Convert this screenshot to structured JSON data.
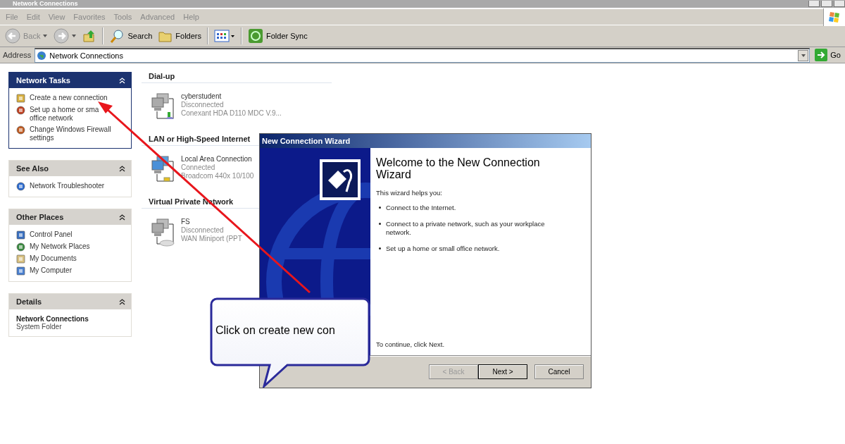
{
  "window": {
    "title": "Network Connections"
  },
  "menu": [
    "File",
    "Edit",
    "View",
    "Favorites",
    "Tools",
    "Advanced",
    "Help"
  ],
  "toolbar": [
    {
      "kind": "back",
      "label": "Back",
      "disabled": true
    },
    {
      "kind": "forward"
    },
    {
      "kind": "up"
    },
    {
      "kind": "separator"
    },
    {
      "kind": "search",
      "label": "Search"
    },
    {
      "kind": "folders",
      "label": "Folders"
    },
    {
      "kind": "separator"
    },
    {
      "kind": "views"
    },
    {
      "kind": "separator"
    },
    {
      "kind": "sync",
      "label": "Folder Sync"
    }
  ],
  "address": {
    "label": "Address",
    "value": "Network Connections",
    "go": "Go"
  },
  "sidebar": [
    {
      "title": "Network Tasks",
      "special": true,
      "expanded": true,
      "kind": "links",
      "items": [
        {
          "kind": "wizard",
          "label": "Create a new connection"
        },
        {
          "kind": "home",
          "label": "Set up a home or sma\noffice network"
        },
        {
          "kind": "firewall",
          "label": "Change Windows Firewall settings"
        }
      ]
    },
    {
      "title": "See Also",
      "special": false,
      "expanded": true,
      "kind": "links",
      "items": [
        {
          "kind": "info",
          "label": "Network Troubleshooter"
        }
      ]
    },
    {
      "title": "Other Places",
      "special": false,
      "expanded": true,
      "kind": "links",
      "items": [
        {
          "kind": "control",
          "label": "Control Panel"
        },
        {
          "kind": "network",
          "label": "My Network Places"
        },
        {
          "kind": "documents",
          "label": "My Documents"
        },
        {
          "kind": "computer",
          "label": "My Computer"
        }
      ]
    },
    {
      "title": "Details",
      "special": false,
      "expanded": true,
      "kind": "details",
      "name": "Network Connections",
      "sub": "System Folder"
    }
  ],
  "groups": [
    {
      "title": "Dial-up",
      "items": [
        {
          "kind": "dialup",
          "name": "cyberstudent",
          "status": "Disconnected",
          "device": "Conexant HDA D110 MDC V.9..."
        }
      ]
    },
    {
      "title": "LAN or High-Speed Internet",
      "items": [
        {
          "kind": "lan",
          "name": "Local Area Connection",
          "status": "Connected",
          "device": "Broadcom 440x 10/100"
        }
      ]
    },
    {
      "title": "Virtual Private Network",
      "items": [
        {
          "kind": "vpn",
          "name": "FS",
          "status": "Disconnected",
          "device": "WAN Miniport (PPT"
        }
      ]
    }
  ],
  "wizard": {
    "title": "New Connection Wizard",
    "heading": "Welcome to the New Connection Wizard",
    "intro": "This wizard helps you:",
    "bullets": [
      "Connect to the Internet.",
      "Connect to a private network, such as your workplace network.",
      "Set up a home or small office network."
    ],
    "continue": "To continue, click Next.",
    "buttons": [
      {
        "label": "< Back",
        "disabled": true,
        "default": false
      },
      {
        "label": "Next >",
        "disabled": false,
        "default": true
      },
      {
        "label": "Cancel",
        "disabled": false,
        "default": false
      }
    ]
  },
  "callout": {
    "text": "Click on create new con"
  }
}
